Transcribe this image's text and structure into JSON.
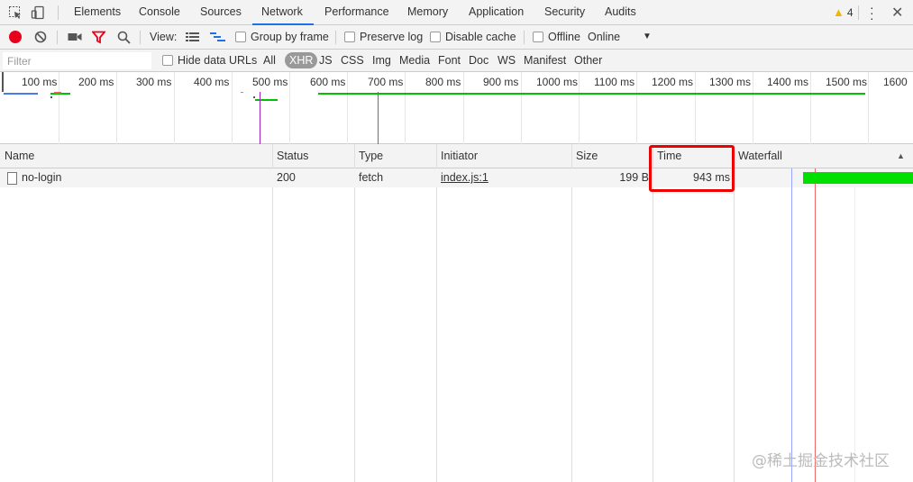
{
  "tabs": [
    "Elements",
    "Console",
    "Sources",
    "Network",
    "Performance",
    "Memory",
    "Application",
    "Security",
    "Audits"
  ],
  "active_tab": "Network",
  "warning_count": "4",
  "toolbar": {
    "view_label": "View:",
    "group_by_frame": "Group by frame",
    "preserve_log": "Preserve log",
    "disable_cache": "Disable cache",
    "offline": "Offline",
    "throttle": "Online"
  },
  "filterbar": {
    "placeholder": "Filter",
    "hide_data_urls": "Hide data URLs",
    "types": [
      "All",
      "XHR",
      "JS",
      "CSS",
      "Img",
      "Media",
      "Font",
      "Doc",
      "WS",
      "Manifest",
      "Other"
    ],
    "selected_type": "XHR"
  },
  "overview": {
    "ticks": [
      "100 ms",
      "200 ms",
      "300 ms",
      "400 ms",
      "500 ms",
      "600 ms",
      "700 ms",
      "800 ms",
      "900 ms",
      "1000 ms",
      "1100 ms",
      "1200 ms",
      "1300 ms",
      "1400 ms",
      "1500 ms",
      "1600"
    ]
  },
  "table": {
    "columns": [
      "Name",
      "Status",
      "Type",
      "Initiator",
      "Size",
      "Time",
      "Waterfall"
    ],
    "rows": [
      {
        "name": "no-login",
        "status": "200",
        "type": "fetch",
        "initiator": "index.js:1",
        "size": "199 B",
        "time": "943 ms"
      }
    ]
  },
  "watermark": "@稀土掘金技术社区",
  "colors": {
    "accent": "#1a73e8",
    "record": "#e8001c",
    "highlight": "#e00000",
    "waterfall_bar": "#00e000"
  }
}
